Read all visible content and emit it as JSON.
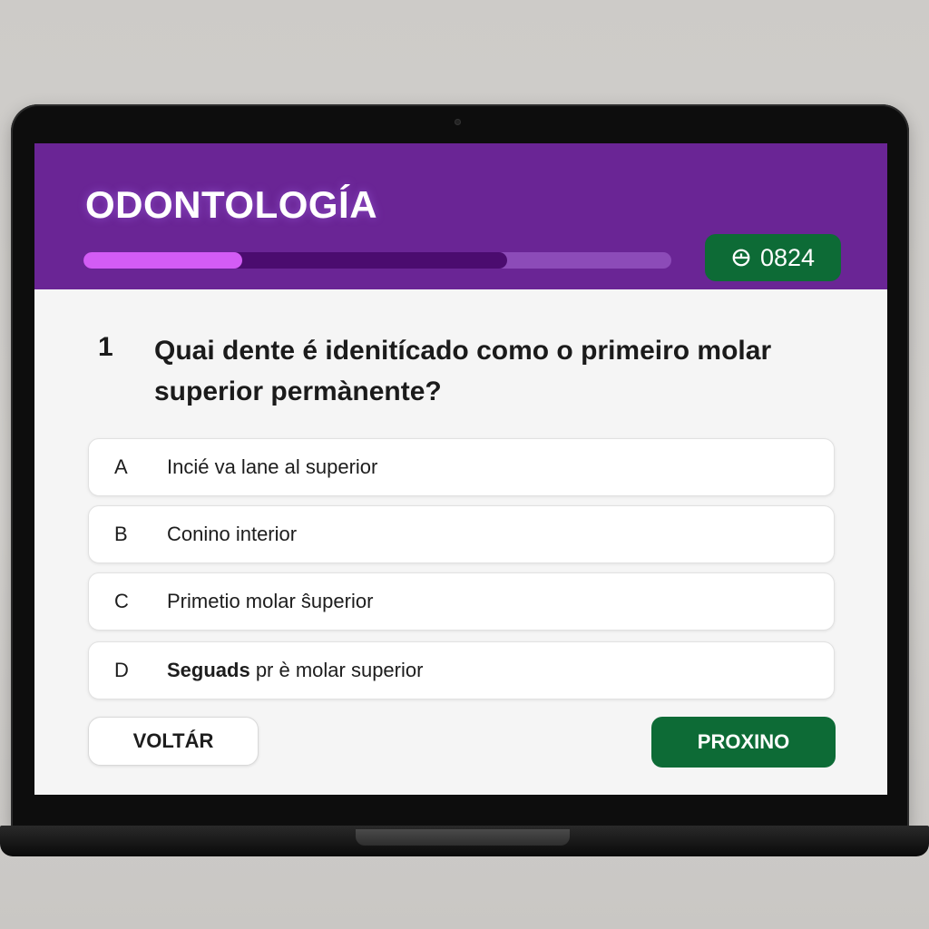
{
  "header": {
    "title": "ODONTOLOGÍA",
    "progress": {
      "answered_fraction": 0.27,
      "loaded_fraction": 0.72
    },
    "timer": {
      "icon": "timer-icon",
      "value": "0824"
    }
  },
  "question": {
    "number": "1",
    "text": "Quai dente é idenitícado como o primeiro molar superior permànente?"
  },
  "options": [
    {
      "letter": "A",
      "label": "Incié va lane al superior"
    },
    {
      "letter": "B",
      "label": "Conino interior"
    },
    {
      "letter": "C",
      "label": "Primetio molar ŝuperior"
    },
    {
      "letter": "D",
      "label_bold": "Seguads",
      "label_rest": " pr è molar superior"
    }
  ],
  "navigation": {
    "back_label": "VOLTÁR",
    "next_label": "PROXINO"
  },
  "colors": {
    "header_purple": "#6a2595",
    "progress_fill": "#d35cf5",
    "action_green": "#0d6b36"
  }
}
